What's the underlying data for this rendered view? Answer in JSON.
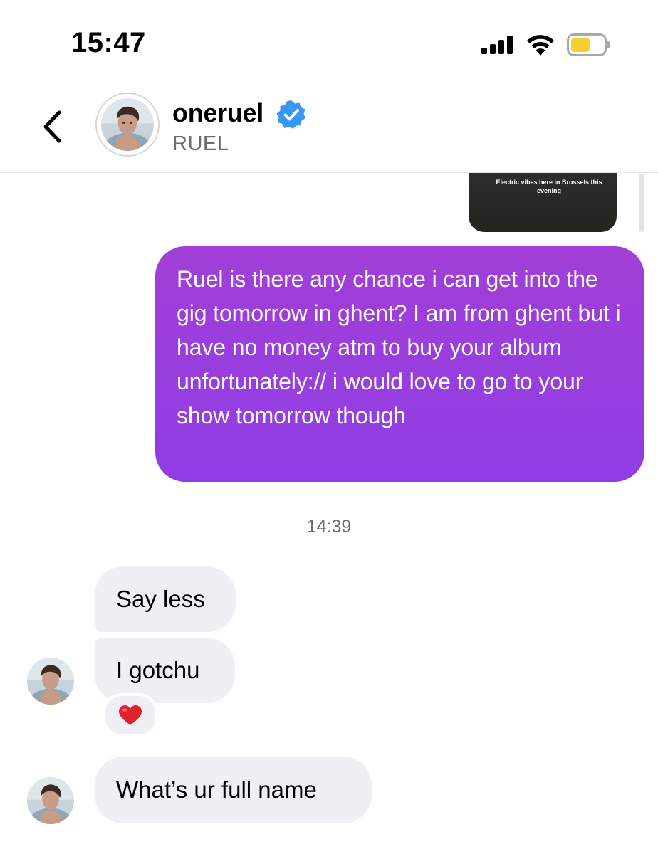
{
  "status_bar": {
    "time": "15:47",
    "signal_icon": "cellular-signal-icon",
    "wifi_icon": "wifi-icon",
    "battery_icon": "battery-low-power-icon",
    "battery_color": "#f5cf2f"
  },
  "header": {
    "back_icon": "chevron-left-icon",
    "username": "oneruel",
    "verified_icon": "verified-badge-icon",
    "verified_color": "#3897f0",
    "subtitle": "RUEL"
  },
  "conversation": {
    "shared_story_caption": "Electric vibes here in Brussels this evening",
    "outgoing_message": "Ruel is there any chance i can get into the gig tomorrow in ghent? I am from ghent but i have no money atm to buy your album unfortunately:// i would love to go to your show tomorrow though",
    "outgoing_gradient": [
      "#a23fd6",
      "#8f3de6"
    ],
    "timestamp": "14:39",
    "incoming_messages": [
      {
        "text": "Say less"
      },
      {
        "text": "I gotchu",
        "reaction": "❤️"
      },
      {
        "text": "What’s ur full name"
      }
    ]
  }
}
